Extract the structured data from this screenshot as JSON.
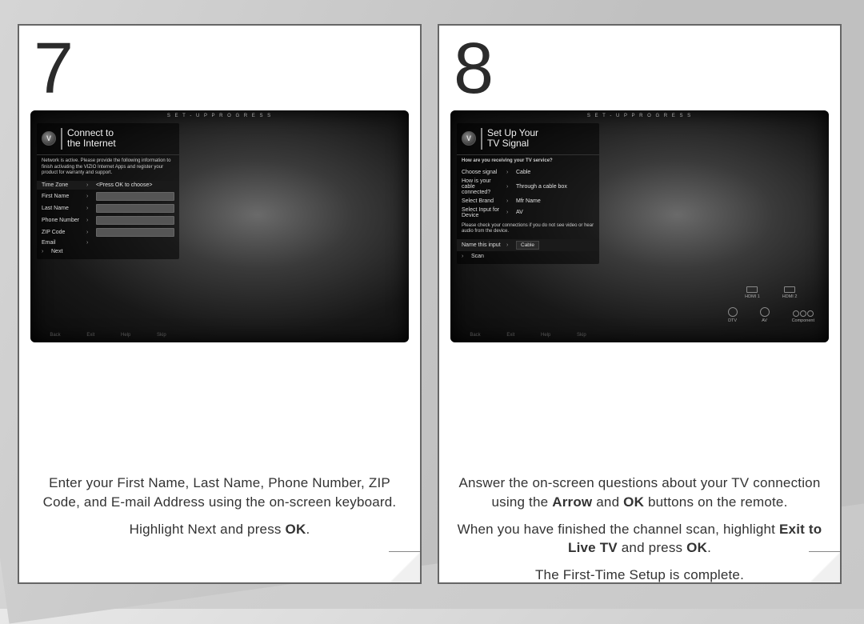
{
  "step7": {
    "number": "7",
    "tv": {
      "topbar": "S E T - U P   P R O G R E S S",
      "title_line1": "Connect to",
      "title_line2": "the Internet",
      "desc": "Network is active. Please provide the following information to finish activating the VIZIO Internet Apps and register your product for warranty and support.",
      "rows": {
        "timezone_label": "Time Zone",
        "timezone_val": "<Press OK to choose>",
        "firstname": "First Name",
        "lastname": "Last Name",
        "phone": "Phone Number",
        "zip": "ZIP Code",
        "email": "Email",
        "next": "Next"
      },
      "bottom": {
        "a": "Back",
        "b": "Exit",
        "c": "Help",
        "d": "Skip"
      }
    },
    "caption": {
      "p1": "Enter your First Name, Last Name, Phone Number, ZIP Code, and E-mail Address using the on-screen keyboard.",
      "p2a": "Highlight Next and press ",
      "p2b": "OK",
      "p2c": "."
    }
  },
  "step8": {
    "number": "8",
    "tv": {
      "topbar": "S E T - U P   P R O G R E S S",
      "title_line1": "Set Up Your",
      "title_line2": "TV Signal",
      "q1": "How are you receiving your TV service?",
      "rows": {
        "choose_label": "Choose signal",
        "choose_val": "Cable",
        "how_label_1": "How is your cable",
        "how_label_2": "connected?",
        "how_val": "Through a cable box",
        "brand_label": "Select Brand",
        "brand_val": "Mfr Name",
        "input_label_1": "Select Input for",
        "input_label_2": "Device",
        "input_val": "AV"
      },
      "desc2": "Please check your connections if you do not see video or hear audio from the device.",
      "name_label": "Name this input",
      "name_val": "Cable",
      "scan": "Scan",
      "bottom": {
        "a": "Back",
        "b": "Exit",
        "c": "Help",
        "d": "Skip"
      },
      "ports": {
        "hdmi1": "HDMI 1",
        "hdmi2": "HDMI 2",
        "dtv": "DTV",
        "av": "AV",
        "comp": "Component"
      }
    },
    "caption": {
      "p1a": "Answer the on-screen questions about your TV connection using the ",
      "p1b": "Arrow",
      "p1c": " and ",
      "p1d": "OK",
      "p1e": " buttons on the remote.",
      "p2a": "When you have finished the channel scan, highlight ",
      "p2b": "Exit to Live TV",
      "p2c": " and press ",
      "p2d": "OK",
      "p2e": ".",
      "p3": "The First-Time Setup is complete."
    }
  }
}
